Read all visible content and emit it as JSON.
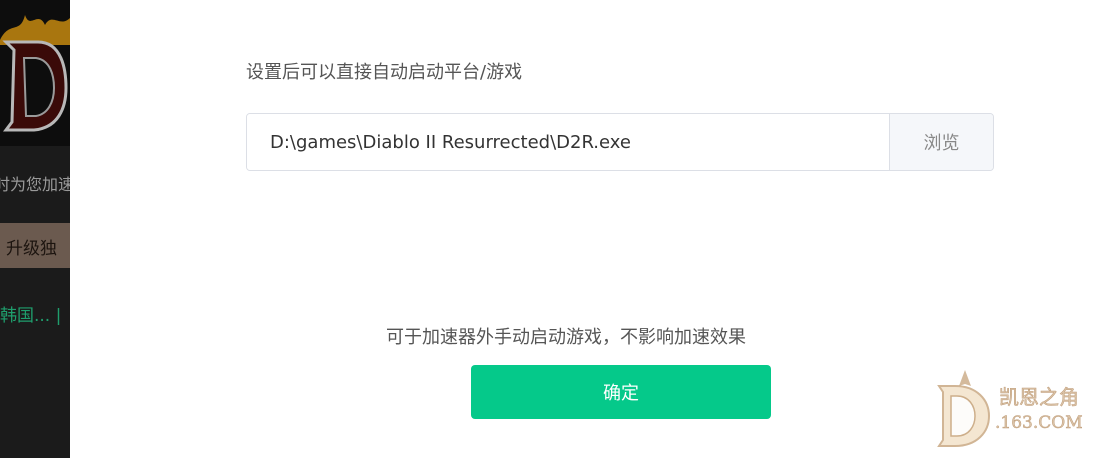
{
  "background": {
    "status_text": "时为您加速",
    "upgrade_label": "升级独",
    "region_text": "韩国... |"
  },
  "dialog": {
    "top_hint": "设置后可以直接自动启动平台/游戏",
    "path_value": "D:\\games\\Diablo II Resurrected\\D2R.exe",
    "browse_label": "浏览",
    "bottom_hint": "可于加速器外手动启动游戏，不影响加速效果",
    "confirm_label": "确定"
  },
  "colors": {
    "accent": "#05c98a",
    "panel_bg": "#1b1b1b",
    "region_green": "#1f9e6d"
  },
  "watermark": {
    "letter": "D",
    "line1": "凯恩之角",
    "line2": ".163.COM"
  }
}
